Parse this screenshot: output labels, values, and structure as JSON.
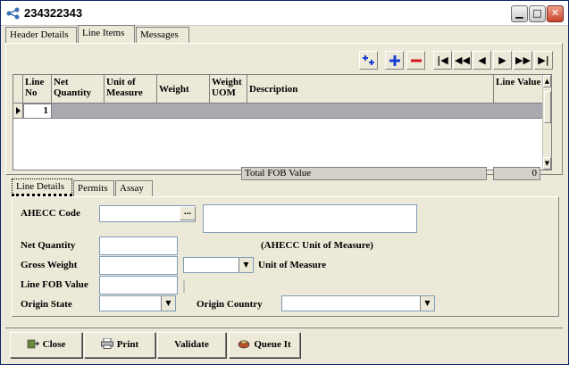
{
  "window": {
    "title": "234322343"
  },
  "tabs_top": [
    {
      "label": "Header Details"
    },
    {
      "label": "Line Items"
    },
    {
      "label": "Messages"
    }
  ],
  "grid": {
    "columns": [
      "Line No",
      "Net Quantity",
      "Unit of Measure",
      "Weight",
      "Weight UOM",
      "Description",
      "Line Value"
    ],
    "rows": [
      {
        "line_no": "1"
      }
    ],
    "total_label": "Total FOB Value",
    "total_value": "0"
  },
  "tabs_bottom": [
    {
      "label": "Line Details"
    },
    {
      "label": "Permits"
    },
    {
      "label": "Assay"
    }
  ],
  "form": {
    "ahecc_code_label": "AHECC Code",
    "ellipsis_label": "...",
    "net_quantity_label": "Net Quantity",
    "ahecc_uom_label": "(AHECC Unit of Measure)",
    "gross_weight_label": "Gross Weight",
    "unit_of_measure_label": "Unit of Measure",
    "line_fob_value_label": "Line FOB Value",
    "origin_state_label": "Origin State",
    "origin_country_label": "Origin Country"
  },
  "buttons": {
    "close": "Close",
    "print": "Print",
    "validate": "Validate",
    "queue_it": "Queue It"
  },
  "colors": {
    "selection_row": "#a9a9b0",
    "add_icon": "#1a3fd0",
    "remove_icon": "#d01818"
  }
}
